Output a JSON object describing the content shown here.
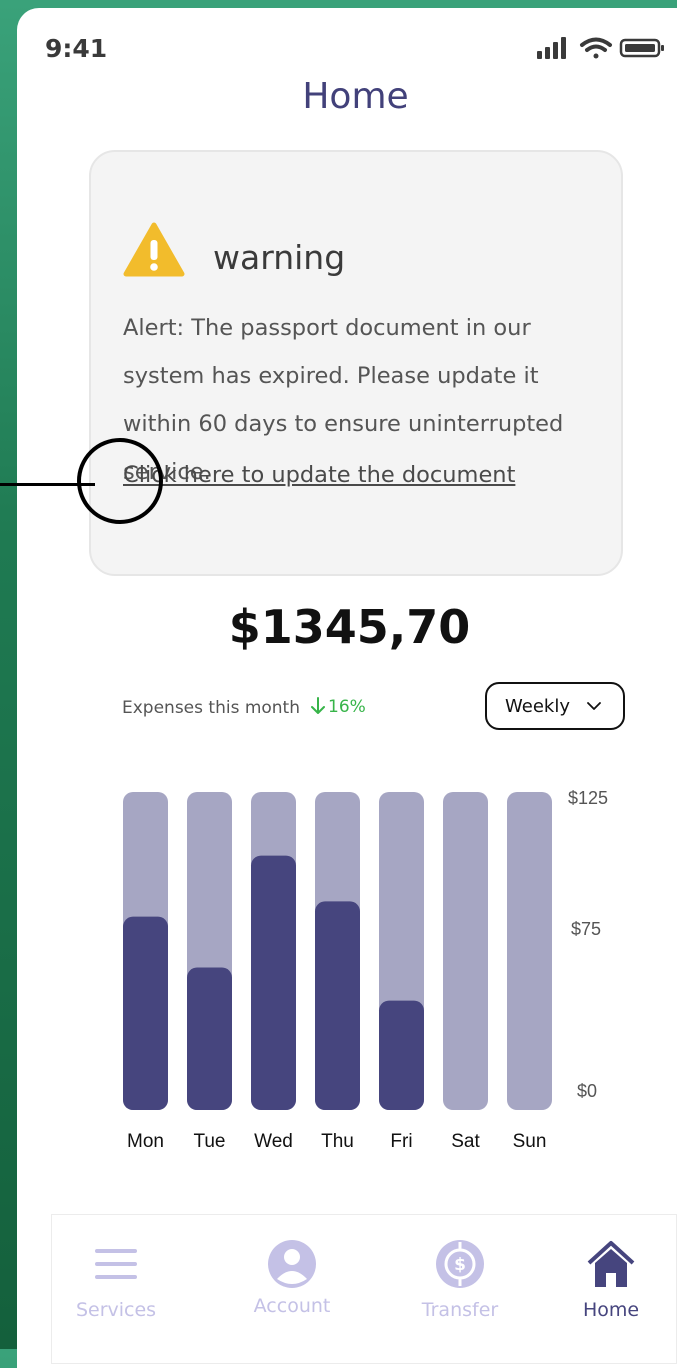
{
  "status_bar": {
    "time": "9:41"
  },
  "header": {
    "title": "Home"
  },
  "alert": {
    "title": "warning",
    "message": "Alert: The passport document in our system has expired. Please update it within 60 days to ensure uninterrupted service.",
    "link": "Click here to update the document"
  },
  "balance": {
    "amount": "$1345,70"
  },
  "expenses": {
    "label": "Expenses this month",
    "change": "16%",
    "change_direction": "down",
    "period": "Weekly"
  },
  "chart_data": {
    "type": "bar",
    "categories": [
      "Mon",
      "Tue",
      "Wed",
      "Thu",
      "Fri",
      "Sat",
      "Sun"
    ],
    "values": [
      76,
      56,
      100,
      82,
      43,
      0,
      0
    ],
    "ylim": [
      0,
      125
    ],
    "yticks": [
      "$125",
      "$75",
      "$0"
    ],
    "colors": {
      "filled": "#46457e",
      "track": "#a6a6c3"
    }
  },
  "nav": {
    "items": [
      {
        "label": "Services",
        "icon": "menu-icon",
        "active": false
      },
      {
        "label": "Account",
        "icon": "user-icon",
        "active": false
      },
      {
        "label": "Transfer",
        "icon": "transfer-icon",
        "active": false
      },
      {
        "label": "Home",
        "icon": "home-icon",
        "active": true
      }
    ]
  },
  "colors": {
    "primary": "#46457e",
    "inactive": "#c4c1e6",
    "success": "#37b449",
    "warning": "#f2bc2c"
  }
}
